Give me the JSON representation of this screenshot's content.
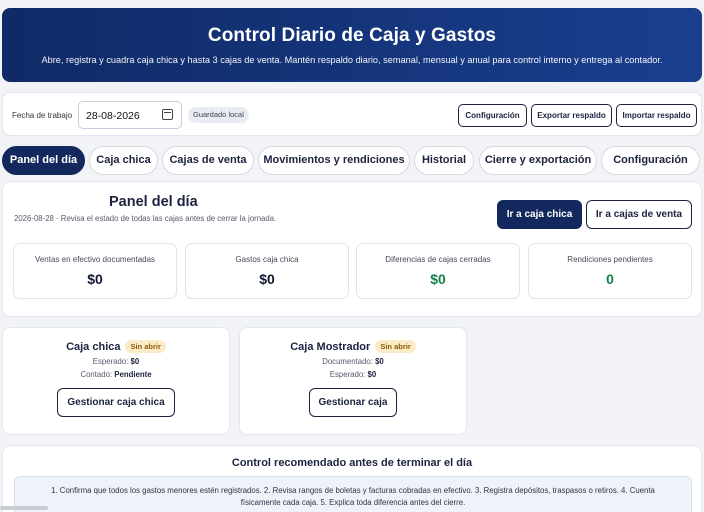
{
  "header": {
    "title": "Control Diario de Caja y Gastos",
    "subtitle": "Abre, registra y cuadra caja chica y hasta 3 cajas de venta. Mantén respaldo diario, semanal, mensual y anual para control interno y entrega al contador."
  },
  "toolbar": {
    "date_label": "Fecha de trabajo",
    "date_value": "28-08-2026",
    "saved_badge": "Guardado local",
    "config_label": "Configuración",
    "export_label": "Exportar respaldo",
    "import_label": "Importar respaldo"
  },
  "tabs": [
    {
      "label": "Panel del día",
      "active": true
    },
    {
      "label": "Caja chica"
    },
    {
      "label": "Cajas de venta"
    },
    {
      "label": "Movimientos y rendiciones"
    },
    {
      "label": "Historial"
    },
    {
      "label": "Cierre y exportación"
    },
    {
      "label": "Configuración"
    }
  ],
  "panel": {
    "title": "Panel del día",
    "subtitle": "2026-08-28 · Revisa el estado de todas las cajas antes de cerrar la jornada.",
    "btn_petty": "Ir a caja chica",
    "btn_sales": "Ir a cajas de venta",
    "kpis": [
      {
        "label": "Ventas en efectivo documentadas",
        "value": "$0"
      },
      {
        "label": "Gastos caja chica",
        "value": "$0"
      },
      {
        "label": "Diferencias de cajas cerradas",
        "value": "$0",
        "color": "#138048"
      },
      {
        "label": "Rendiciones pendientes",
        "value": "0",
        "color": "#138048"
      }
    ]
  },
  "cards": [
    {
      "title": "Caja chica",
      "status": "Sin abrir",
      "line1_label": "Esperado:",
      "line1_value": "$0",
      "line2_label": "Contado:",
      "line2_value": "Pendiente",
      "button": "Gestionar caja chica"
    },
    {
      "title": "Caja Mostrador",
      "status": "Sin abrir",
      "line1_label": "Documentado:",
      "line1_value": "$0",
      "line2_label": "Esperado:",
      "line2_value": "$0",
      "button": "Gestionar caja"
    }
  ],
  "recommendation": {
    "title": "Control recomendado antes de terminar el día",
    "text": "1. Confirma que todos los gastos menores estén registrados. 2. Revisa rangos de boletas y facturas cobradas en efectivo. 3. Registra depósitos, traspasos o retiros. 4. Cuenta físicamente cada caja. 5. Explica toda diferencia antes del cierre."
  },
  "colors": {
    "primary": "#13295e",
    "success": "#138048",
    "warning_bg": "#fbecc8"
  }
}
